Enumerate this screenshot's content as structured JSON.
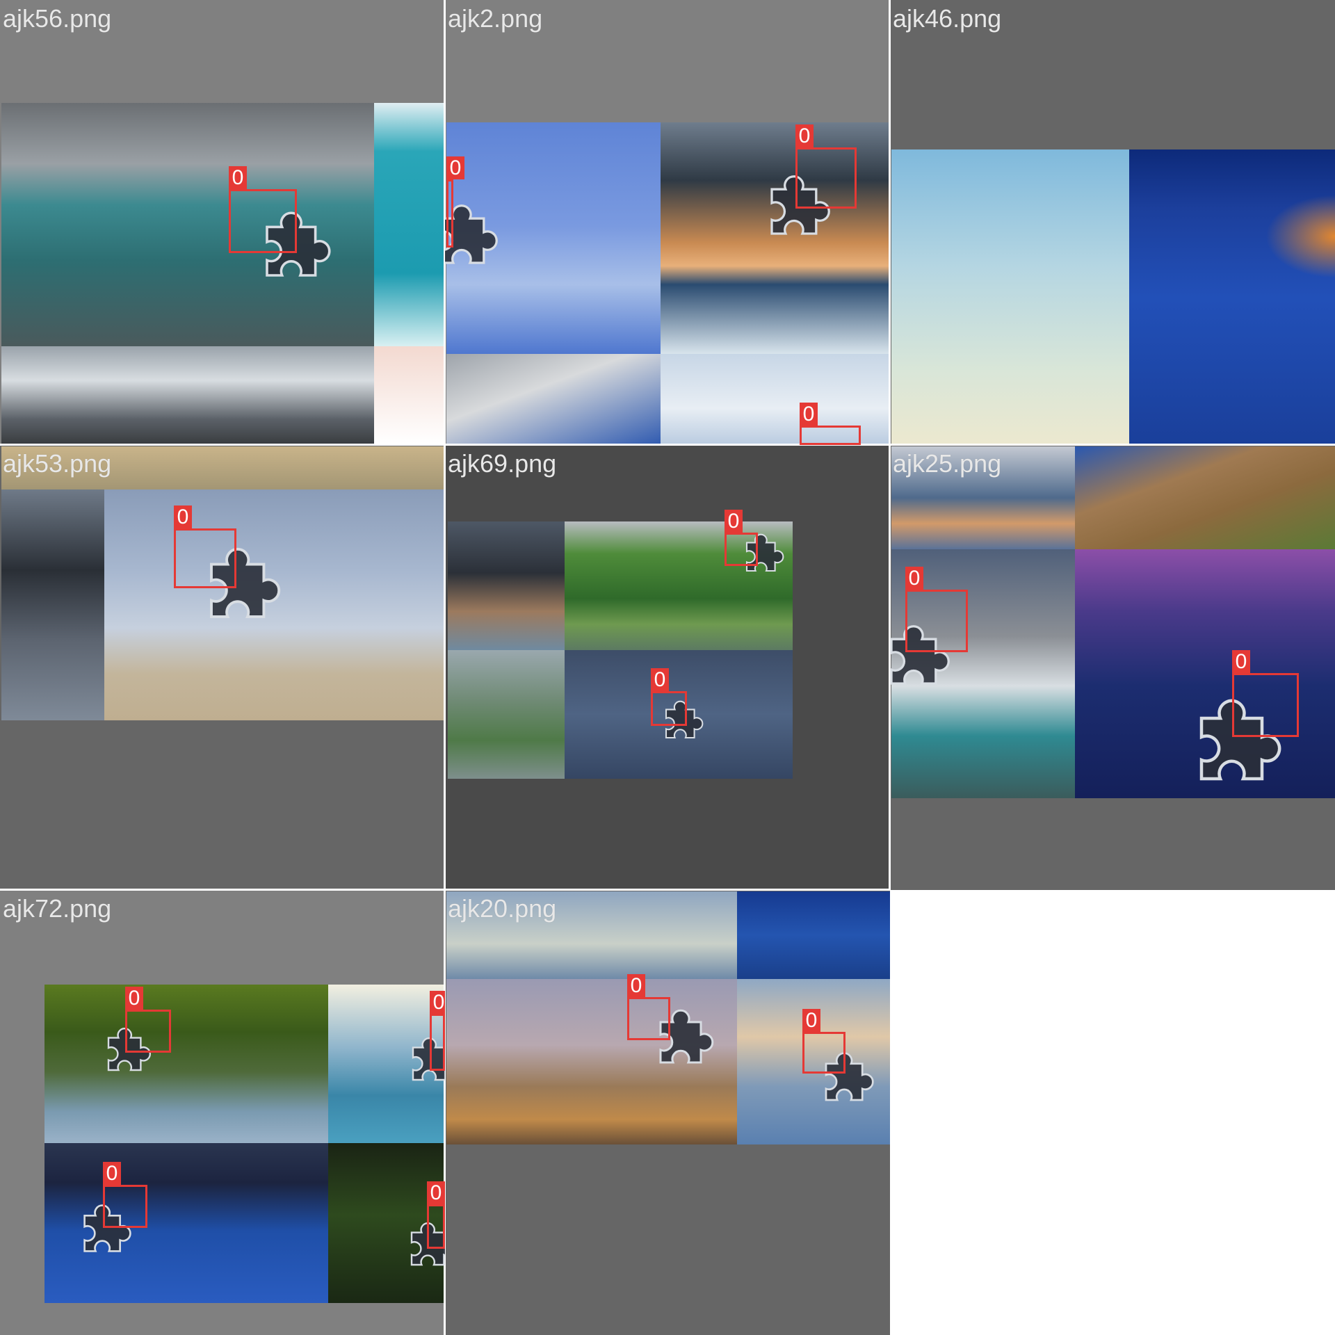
{
  "colors": {
    "box": "#e53935",
    "box_label_text": "#ffffff",
    "title_text": "#e8e8e8",
    "piece_fill": "#2a2f38",
    "piece_stroke": "#d8dde3"
  },
  "cells": [
    {
      "title": "ajk56.png",
      "detections": [
        {
          "label": "0"
        }
      ]
    },
    {
      "title": "ajk2.png",
      "detections": [
        {
          "label": "0"
        },
        {
          "label": "0"
        },
        {
          "label": "0"
        }
      ]
    },
    {
      "title": "ajk46.png",
      "detections": []
    },
    {
      "title": "ajk53.png",
      "detections": [
        {
          "label": "0"
        }
      ]
    },
    {
      "title": "ajk69.png",
      "detections": [
        {
          "label": "0"
        },
        {
          "label": "0"
        }
      ]
    },
    {
      "title": "ajk25.png",
      "detections": [
        {
          "label": "0"
        },
        {
          "label": "0"
        }
      ]
    },
    {
      "title": "ajk72.png",
      "detections": [
        {
          "label": "0"
        },
        {
          "label": "0"
        },
        {
          "label": "0"
        },
        {
          "label": "0"
        }
      ]
    },
    {
      "title": "ajk20.png",
      "detections": [
        {
          "label": "0"
        },
        {
          "label": "0"
        }
      ]
    }
  ]
}
